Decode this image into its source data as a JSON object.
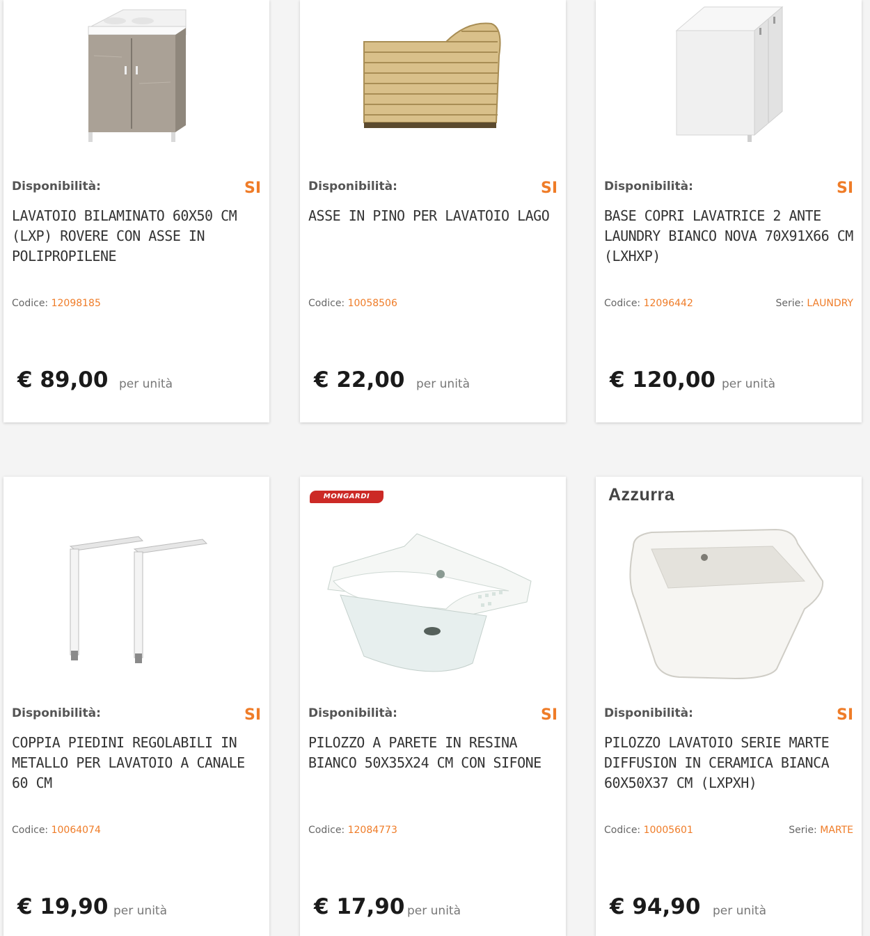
{
  "products": [
    {
      "availability_label": "Disponibilità:",
      "availability_value": "SI",
      "title": "LAVATOIO BILAMINATO 60X50 CM (LXP) ROVERE CON ASSE IN POLIPROPILENE",
      "code_label": "Codice:",
      "code": "12098185",
      "price": "€ 89,00",
      "unit": "per unità"
    },
    {
      "availability_label": "Disponibilità:",
      "availability_value": "SI",
      "title": "ASSE IN PINO PER LAVATOIO LAGO",
      "code_label": "Codice:",
      "code": "10058506",
      "price": "€ 22,00",
      "unit": "per unità"
    },
    {
      "availability_label": "Disponibilità:",
      "availability_value": "SI",
      "title": "BASE COPRI LAVATRICE 2 ANTE LAUNDRY BIANCO NOVA 70X91X66 CM (LXHXP)",
      "code_label": "Codice:",
      "code": "12096442",
      "series_label": "Serie:",
      "series": "LAUNDRY",
      "price": "€ 120,00",
      "unit": "per unità"
    },
    {
      "availability_label": "Disponibilità:",
      "availability_value": "SI",
      "title": "COPPIA PIEDINI REGOLABILI IN METALLO PER LAVATOIO A CANALE 60 CM",
      "code_label": "Codice:",
      "code": "10064074",
      "price": "€ 19,90",
      "unit": "per unità"
    },
    {
      "brand": "MONGARDI",
      "availability_label": "Disponibilità:",
      "availability_value": "SI",
      "title": "PILOZZO A PARETE IN RESINA BIANCO 50X35X24 CM CON SIFONE",
      "code_label": "Codice:",
      "code": "12084773",
      "price": "€ 17,90",
      "unit": "per unità"
    },
    {
      "brand": "Azzurra",
      "availability_label": "Disponibilità:",
      "availability_value": "SI",
      "title": "PILOZZO LAVATOIO SERIE MARTE DIFFUSION IN CERAMICA BIANCA 60X50X37 CM (LXPXH)",
      "code_label": "Codice:",
      "code": "10005601",
      "series_label": "Serie:",
      "series": "MARTE",
      "price": "€ 94,90",
      "unit": "per unità"
    }
  ],
  "colors": {
    "accent": "#ef7c28",
    "text": "#333333",
    "card_bg": "#ffffff",
    "page_bg": "#f4f4f4"
  }
}
